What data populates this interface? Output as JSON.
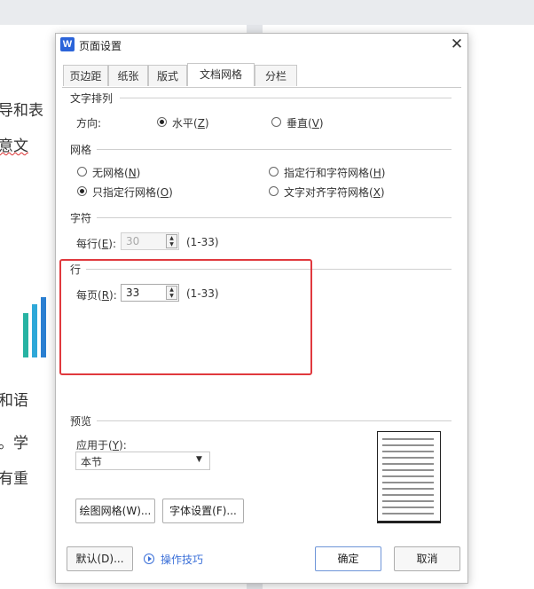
{
  "background_doc": {
    "lines": [
      "导和表",
      "意文",
      "和语",
      "。学",
      "有重"
    ]
  },
  "dialog": {
    "title": "页面设置",
    "app_icon_letter": "W",
    "close_glyph": "✕",
    "tabs": [
      {
        "label": "页边距",
        "active": false
      },
      {
        "label": "纸张",
        "active": false
      },
      {
        "label": "版式",
        "active": false
      },
      {
        "label": "文档网格",
        "active": true
      },
      {
        "label": "分栏",
        "active": false
      }
    ],
    "text_direction": {
      "section": "文字排列",
      "direction_label": "方向:",
      "horizontal": {
        "text": "水平(",
        "key": "Z",
        "end": ")",
        "selected": true
      },
      "vertical": {
        "text": "垂直(",
        "key": "V",
        "end": ")",
        "selected": false
      }
    },
    "grid": {
      "section": "网格",
      "none": {
        "text": "无网格(",
        "key": "N",
        "end": ")",
        "selected": false
      },
      "line_only": {
        "text": "只指定行网格(",
        "key": "O",
        "end": ")",
        "selected": true
      },
      "line_and_char": {
        "text": "指定行和字符网格(",
        "key": "H",
        "end": ")",
        "selected": false
      },
      "align_char": {
        "text": "文字对齐字符网格(",
        "key": "X",
        "end": ")",
        "selected": false
      }
    },
    "chars": {
      "section": "字符",
      "per_line_label_pre": "每行(",
      "per_line_key": "E",
      "per_line_label_post": "):",
      "value": "30",
      "range": "(1-33)"
    },
    "lines": {
      "section": "行",
      "per_page_label_pre": "每页(",
      "per_page_key": "R",
      "per_page_label_post": "):",
      "value": "33",
      "range": "(1-33)"
    },
    "preview": {
      "section": "预览",
      "apply_label_pre": "应用于(",
      "apply_key": "Y",
      "apply_label_post": "):",
      "apply_value": "本节"
    },
    "buttons": {
      "draw_grid": "绘图网格(W)...",
      "font_settings": "字体设置(F)...",
      "default": "默认(D)...",
      "tips": "操作技巧",
      "ok": "确定",
      "cancel": "取消"
    },
    "colors": {
      "highlight": "#e0393e",
      "link": "#3a6fd8",
      "app_icon": "#2b64d9"
    }
  }
}
